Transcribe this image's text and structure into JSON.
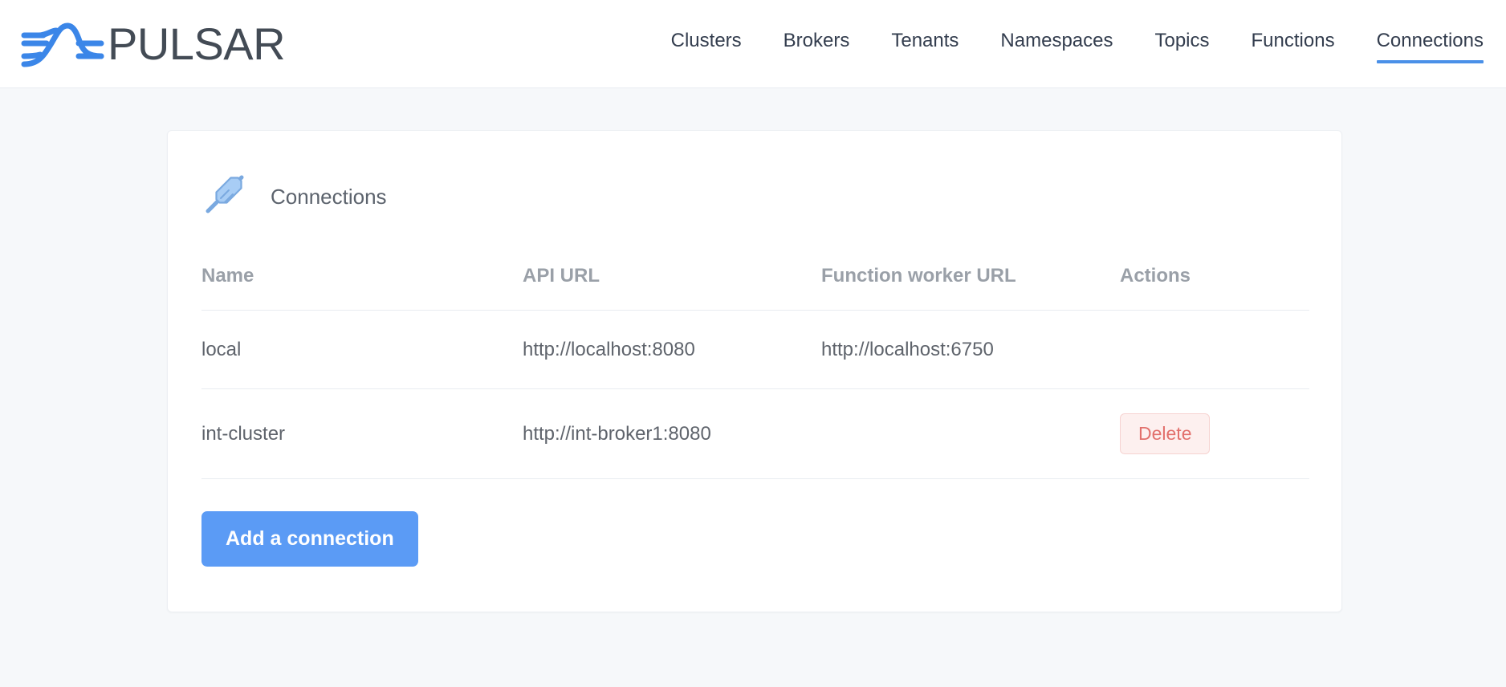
{
  "brand": {
    "name": "PULSAR",
    "logo_icon": "pulsar-wave-logo",
    "logo_color": "#3b86e8",
    "wordmark_color": "#434b55"
  },
  "nav": {
    "items": [
      {
        "label": "Clusters",
        "active": false
      },
      {
        "label": "Brokers",
        "active": false
      },
      {
        "label": "Tenants",
        "active": false
      },
      {
        "label": "Namespaces",
        "active": false
      },
      {
        "label": "Topics",
        "active": false
      },
      {
        "label": "Functions",
        "active": false
      },
      {
        "label": "Connections",
        "active": true
      }
    ],
    "active_underline_color": "#4a90e8"
  },
  "card": {
    "icon": "plug-connector-icon",
    "icon_color": "#a8cdf5",
    "title": "Connections"
  },
  "table": {
    "columns": [
      "Name",
      "API URL",
      "Function worker URL",
      "Actions"
    ],
    "rows": [
      {
        "name": "local",
        "api_url": "http://localhost:8080",
        "function_worker_url": "http://localhost:6750",
        "action_label": "",
        "has_action": false
      },
      {
        "name": "int-cluster",
        "api_url": "http://int-broker1:8080",
        "function_worker_url": "",
        "action_label": "Delete",
        "has_action": true
      }
    ]
  },
  "footer": {
    "add_button_label": "Add a connection",
    "add_button_color": "#5b9bf5",
    "delete_button_text_color": "#e2706c",
    "delete_button_bg_color": "#fdf0ef"
  }
}
